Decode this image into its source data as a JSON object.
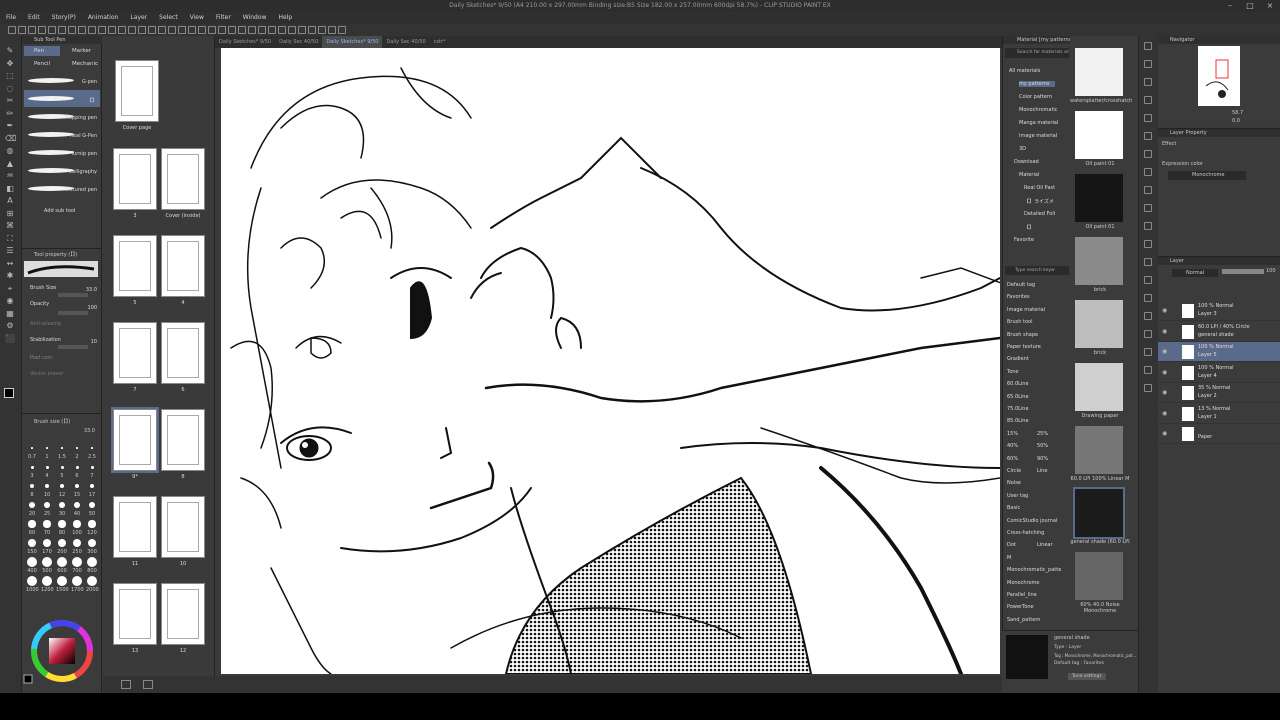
{
  "app": {
    "title": "Daily Sketches* 9/50 (A4 210.00 x 297.00mm Binding size:B5 Size 182.00 x 257.00mm 600dpi 58.7%) - CLIP STUDIO PAINT EX"
  },
  "menu": [
    "File",
    "Edit",
    "Story(P)",
    "Animation",
    "Layer",
    "Select",
    "View",
    "Filter",
    "Window",
    "Help"
  ],
  "tabs": [
    "Daily Sketches* 9/50",
    "Daily Sec 40/50",
    "Daily Sketches* 9/50",
    "Daily Sec 40/50",
    "cstr*"
  ],
  "subtool": {
    "header": "Sub Tool Pen",
    "tabs": [
      "Pen",
      "Marker",
      "Pencil",
      "Mechanic"
    ],
    "brushes": [
      "G-pen",
      "【】",
      "Mapping pen",
      "Real G-Pen",
      "Turnip pen",
      "Calligraphy",
      "Textured pen"
    ],
    "add": "Add sub tool"
  },
  "toolprop": {
    "header": "Tool property (【】)",
    "brush_size_label": "Brush Size",
    "brush_size_value": "33.0",
    "opacity_label": "Opacity",
    "opacity_value": "100",
    "anti_label": "Anti-aliasing",
    "stab_label": "Stabilization",
    "stab_value": "10",
    "post_label": "Post corr.",
    "vector_label": "Vector eraser"
  },
  "brushsize": {
    "header": "Brush size (【】)",
    "value": "33.0",
    "labels": [
      "0.7",
      "1",
      "1.5",
      "2",
      "2.5",
      "3",
      "4",
      "5",
      "6",
      "7",
      "8",
      "10",
      "12",
      "15",
      "17",
      "20",
      "25",
      "30",
      "40",
      "50",
      "60",
      "70",
      "80",
      "100",
      "120",
      "150",
      "170",
      "200",
      "250",
      "300",
      "400",
      "500",
      "600",
      "700",
      "800",
      "1000",
      "1200",
      "1500",
      "1700",
      "2000"
    ]
  },
  "pages": [
    {
      "label": "Cover page"
    },
    {
      "label": "3"
    },
    {
      "label": "Cover (inside)"
    },
    {
      "label": "5"
    },
    {
      "label": "4"
    },
    {
      "label": "7"
    },
    {
      "label": "6"
    },
    {
      "label": "9*"
    },
    {
      "label": "8"
    },
    {
      "label": "11"
    },
    {
      "label": "10"
    },
    {
      "label": "13"
    },
    {
      "label": "12"
    }
  ],
  "materials": {
    "header": "Material [my patterns]",
    "search": "Search for materials on",
    "tree": [
      "All materials",
      "my patterns",
      "Color pattern",
      "Monochromatic",
      "Manga material",
      "Image material",
      "3D",
      "Download",
      "Material",
      "Real Oil Past",
      "【】ライズメ",
      "Detailed Foli",
      "【】",
      "Favorite"
    ],
    "tag_search": "Type search keyw",
    "tags": [
      "Default tag",
      "Favorites",
      "Image material",
      "Brush tool",
      "Brush shape",
      "Paper texture",
      "Gradient",
      "Tone",
      "60.0Line",
      "65.0Line",
      "75.0Line",
      "85.0Line",
      "15%",
      "25%",
      "40%",
      "50%",
      "60%",
      "90%",
      "Circle",
      "Line",
      "Noise",
      "User tag",
      "Basic",
      "ComicStudio journal",
      "Cross-hatching",
      "Dot",
      "Linear",
      "M",
      "Monochromatic_patte",
      "Monochrome",
      "Parallel_line",
      "PowerTone",
      "Sand_pattern"
    ],
    "thumbs": [
      "watersplatter/crosshatch",
      "Oil paint 01",
      "Oil paint 01",
      "brick",
      "brick",
      "Drawing paper",
      "60.0 LPI 100% Linear M",
      "general shade (60.0 LPI",
      "60% 40.0 Noise Monochrome"
    ],
    "detail_name": "general shade",
    "detail_type": "Type : Layer",
    "detail_tag": "Tag : Monochrome, Monochromatic_pat...",
    "detail_default": "Default tag : Favorites",
    "tone_settings": "Tone settings"
  },
  "navigator": {
    "header": "Navigator",
    "zoom": "58.7",
    "angle": "0.0"
  },
  "layerprop": {
    "header": "Layer Property",
    "effect": "Effect",
    "expression": "Expression color",
    "expression_value": "Monochrome"
  },
  "layers": {
    "header": "Layer",
    "blend": "Normal",
    "opacity": "100",
    "rows": [
      {
        "mode": "100 % Normal",
        "name": "Layer 3"
      },
      {
        "mode": "60.0 LPI / 40% Circle",
        "name": "general shade"
      },
      {
        "mode": "100 % Normal",
        "name": "Layer 5"
      },
      {
        "mode": "100 % Normal",
        "name": "Layer 4"
      },
      {
        "mode": "35 % Normal",
        "name": "Layer 2"
      },
      {
        "mode": "13 % Normal",
        "name": "Layer 1"
      },
      {
        "mode": "",
        "name": "Paper"
      }
    ]
  },
  "colors": {
    "accent": "#3c78d8",
    "panel": "#3b3b3b",
    "selected": "#5a6a8a"
  }
}
